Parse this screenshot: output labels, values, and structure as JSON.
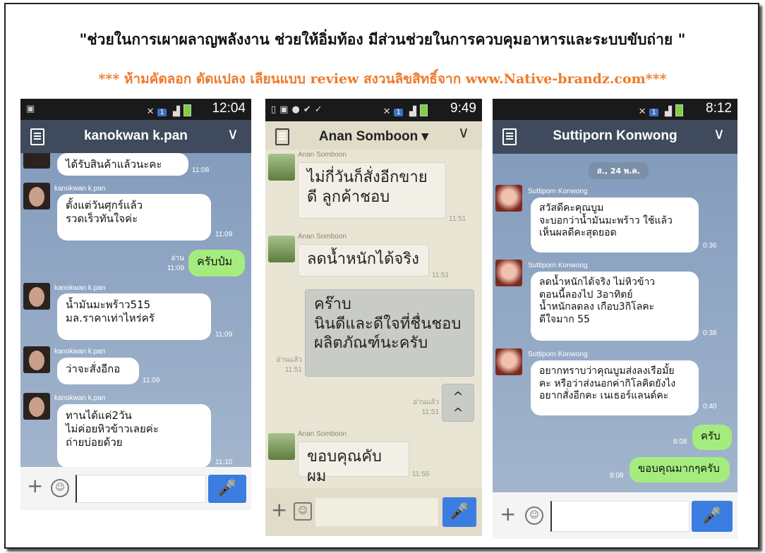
{
  "headline": "\"ช่วยในการเผาผลาญพลังงาน ช่วยให้อิ่มท้อง มีส่วนช่วยในการควบคุมอาหารและระบบขับถ่าย \"",
  "subline": "*** ห้ามคัดลอก ดัดแปลง เลียนแบบ review สงวนลิขสิทธิ์จาก www.Native-brandz.com***",
  "colors": {
    "accent_orange": "#ee7a2a",
    "line_green": "#a5ec7e",
    "titlebar_blue": "#3f4a5c",
    "mic_blue": "#3b7de0"
  },
  "phones": [
    {
      "time": "12:04",
      "contact": "kanokwan k.pan",
      "messages": [
        {
          "text": "ได้รับสินค้าแล้วนะคะ",
          "time": "11:08"
        },
        {
          "sender": "kanokwan k.pan",
          "text": "ตั้งแต่วันศุกร์แล้ว\nรวดเร็วทันใจค่ะ",
          "time": "11:09"
        },
        {
          "text": "ครับป๋ม",
          "read": "อ่าน",
          "time": "11:09"
        },
        {
          "sender": "kanokwan k.pan",
          "text": "น้ำมันมะพร้าว515\nมล.ราคาเท่าไหร่ครั",
          "time": "11:09"
        },
        {
          "sender": "kanokwan k.pan",
          "text": "ว่าจะสั่งอีกอ",
          "time": "11:09"
        },
        {
          "sender": "kanokwan k.pan",
          "text": "ทานได้แค่2วัน\nไม่ค่อยหิวข้าวเลยค่ะ\nถ่ายบ่อยด้วย",
          "time": "11:10"
        }
      ]
    },
    {
      "time": "9:49",
      "contact": "Anan Somboon ▾",
      "messages": [
        {
          "sender": "Anan Somboon",
          "text": "ไม่กี่วันก็สั่งอีกขาย\nดี ลูกค้าชอบ",
          "time": "11:51"
        },
        {
          "sender": "Anan Somboon",
          "text": "ลดน้ำหนักได้จริง",
          "time": "11:51"
        },
        {
          "text": "คร๊าบ\nนินดีและดีใจที่ชื่นชอบ\nผลิตภัณฑ์นะครับ",
          "read": "อ่านแล้ว",
          "time": "11:51"
        },
        {
          "text": "^ ^",
          "read": "อ่านแล้ว",
          "time": "11:51"
        },
        {
          "sender": "Anan Somboon",
          "text": "ขอบคุณคับผม",
          "time": "11:56"
        }
      ]
    },
    {
      "time": "8:12",
      "contact": "Suttiporn Konwong",
      "date": "ส., 24 พ.ค.",
      "messages": [
        {
          "sender": "Suttiporn Konwong",
          "text": "สวัสดีคะคุณบูม\nจะบอกว่าน้ำมันมะพร้าว ใช้แล้ว\nเห็นผลดีคะสุดยอด",
          "time": "0:36"
        },
        {
          "sender": "Suttiporn Konwong",
          "text": "ลดน้ำหนักได้จริง ไม่หิวข้าว\nตอนนี้ลองไป 3อาทิตย์\nน้ำหนักลดลง เกือบ3กิโลคะ\nดีใจมาก 55",
          "time": "0:38"
        },
        {
          "sender": "Suttiporn Konwong",
          "text": "อยากทราบว่าคุณบูมส่งลงเรือมั้ย\nคะ หรือว่าส่งนอกค่ากิโลคิดยังไง\nอยากสั่งอีกคะ เนเธอร์แลนด์คะ",
          "time": "0:40"
        },
        {
          "text": "ครับ",
          "time": "8:08"
        },
        {
          "text": "ขอบคุณมากๆครับ",
          "time": "8:08"
        }
      ]
    }
  ]
}
